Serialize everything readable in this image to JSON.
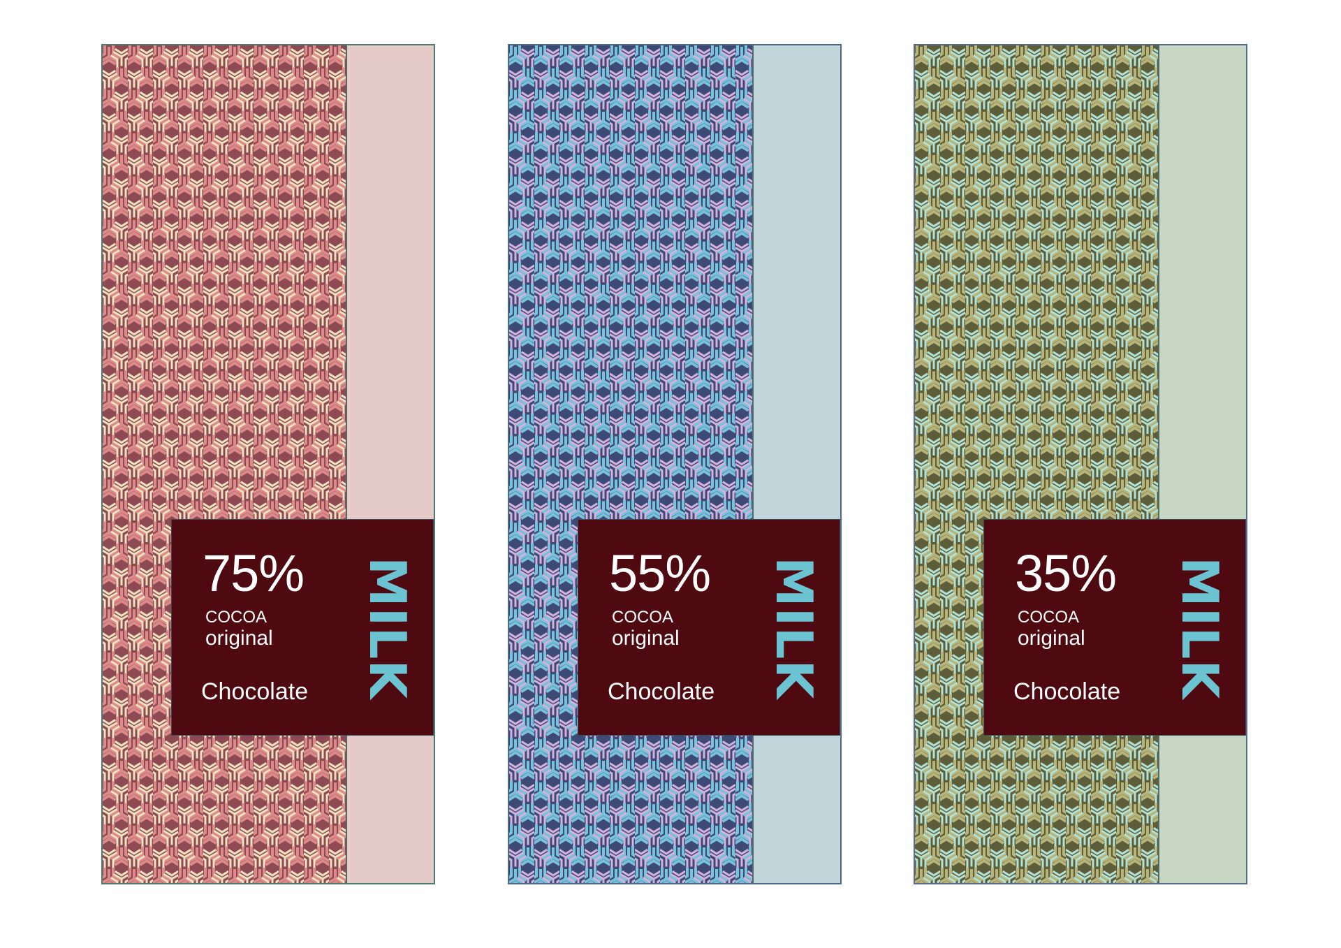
{
  "wrappers": [
    {
      "percent": "75%",
      "cocoa": "COCOA",
      "original": "original",
      "type": "Chocolate",
      "milk": "MILK",
      "colors": {
        "pattern_dark": "#8e4a52",
        "pattern_mid": "#dd8a8a",
        "pattern_light": "#f1e3c2",
        "side": "#e4cbc7",
        "label_bg": "#4e0a10",
        "milk": "#6cc4d2"
      }
    },
    {
      "percent": "55%",
      "cocoa": "COCOA",
      "original": "original",
      "type": "Chocolate",
      "milk": "MILK",
      "colors": {
        "pattern_dark": "#3e4a76",
        "pattern_mid": "#79c2dc",
        "pattern_light": "#d4b4de",
        "side": "#c0d6da",
        "label_bg": "#4e0a10",
        "milk": "#6cc4d2"
      }
    },
    {
      "percent": "35%",
      "cocoa": "COCOA",
      "original": "original",
      "type": "Chocolate",
      "milk": "MILK",
      "colors": {
        "pattern_dark": "#5d5d3a",
        "pattern_mid": "#b8b57c",
        "pattern_light": "#b4e3d6",
        "side": "#c8d6c4",
        "label_bg": "#4e0a10",
        "milk": "#6cc4d2"
      }
    }
  ]
}
